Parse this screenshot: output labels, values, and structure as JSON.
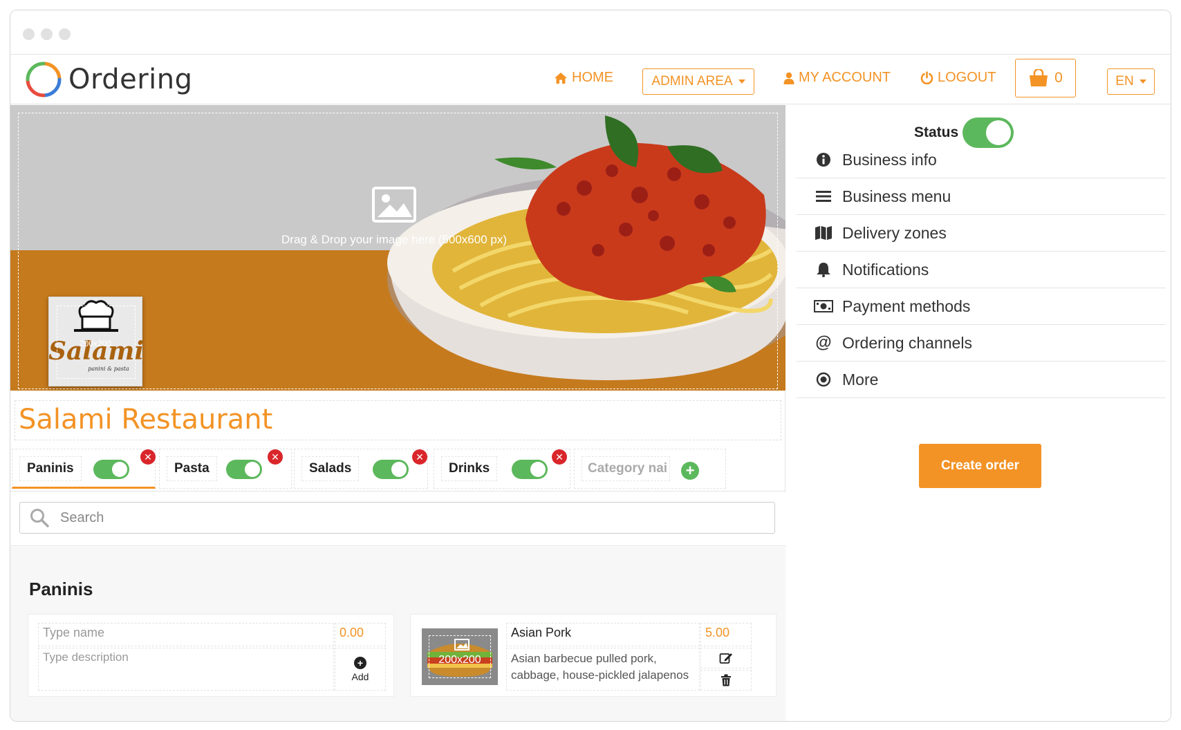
{
  "app": {
    "logo_text": "Ordering"
  },
  "nav": {
    "home": "HOME",
    "admin_area": "ADMIN AREA",
    "my_account": "MY ACCOUNT",
    "logout": "LOGOUT",
    "cart_count": "0",
    "language": "EN"
  },
  "hero": {
    "upload_hint": "Drag & Drop your image here (500x600 px)",
    "logo_size_hint": "200x200",
    "logo_brand": "Salami",
    "logo_tagline": "panini & pasta"
  },
  "restaurant": {
    "name": "Salami Restaurant"
  },
  "categories": [
    {
      "name": "Paninis",
      "enabled": true,
      "active": true
    },
    {
      "name": "Pasta",
      "enabled": true,
      "active": false
    },
    {
      "name": "Salads",
      "enabled": true,
      "active": false
    },
    {
      "name": "Drinks",
      "enabled": true,
      "active": false
    }
  ],
  "new_category": {
    "placeholder": "Category nai"
  },
  "search": {
    "placeholder": "Search"
  },
  "section": {
    "title": "Paninis"
  },
  "new_product": {
    "name_placeholder": "Type name",
    "price_placeholder": "0.00",
    "description_placeholder": "Type description",
    "add_label": "Add"
  },
  "products": [
    {
      "name": "Asian Pork",
      "price": "5.00",
      "description_line1": "Asian barbecue pulled pork,",
      "description_line2": "cabbage, house-pickled jalapenos",
      "image_hint": "200x200"
    }
  ],
  "sidebar": {
    "status_label": "Status",
    "status_enabled": true,
    "items": [
      {
        "label": "Business info",
        "icon": "info-circle-icon"
      },
      {
        "label": "Business menu",
        "icon": "hamburger-icon"
      },
      {
        "label": "Delivery zones",
        "icon": "map-icon"
      },
      {
        "label": "Notifications",
        "icon": "bell-icon"
      },
      {
        "label": "Payment methods",
        "icon": "money-icon"
      },
      {
        "label": "Ordering channels",
        "icon": "at-icon"
      },
      {
        "label": "More",
        "icon": "dot-circle-icon"
      }
    ],
    "create_order": "Create order"
  },
  "colors": {
    "accent": "#f39325",
    "toggle_on": "#5cb85c",
    "remove": "#d9262b"
  }
}
